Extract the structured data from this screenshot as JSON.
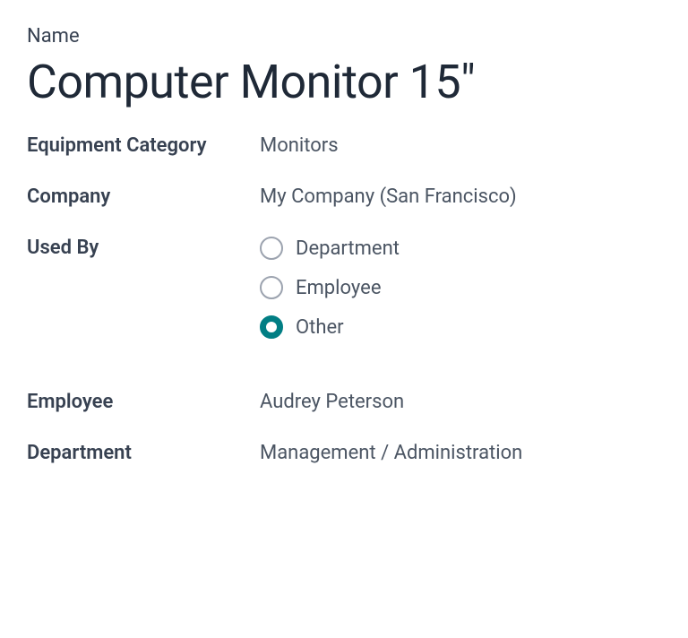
{
  "labels": {
    "name": "Name",
    "equipment_category": "Equipment Category",
    "company": "Company",
    "used_by": "Used By",
    "employee": "Employee",
    "department": "Department"
  },
  "values": {
    "name": "Computer Monitor 15\"",
    "equipment_category": "Monitors",
    "company": "My Company (San Francisco)",
    "employee": "Audrey Peterson",
    "department": "Management / Administration"
  },
  "used_by": {
    "options": [
      {
        "label": "Department",
        "selected": false
      },
      {
        "label": "Employee",
        "selected": false
      },
      {
        "label": "Other",
        "selected": true
      }
    ]
  }
}
